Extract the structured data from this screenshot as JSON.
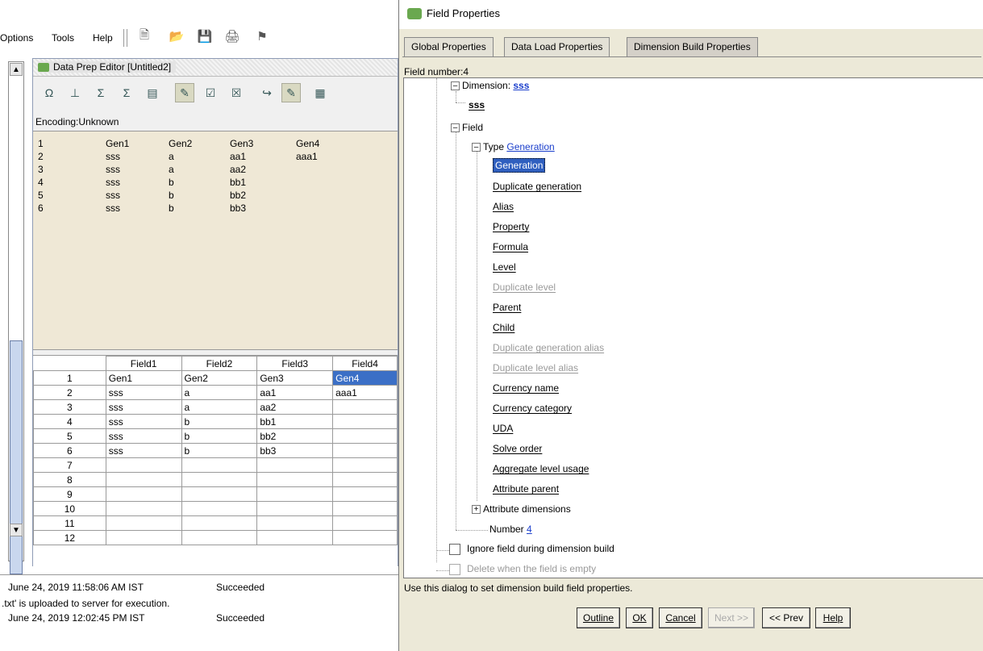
{
  "menus": [
    "Options",
    "Tools",
    "Help"
  ],
  "toolbar_icons": [
    "new-icon",
    "open-icon",
    "save-icon",
    "print-icon",
    "server-icon"
  ],
  "editor": {
    "title": "Data Prep Editor [Untitled2]",
    "encoding": "Encoding:Unknown",
    "raw_rows": [
      [
        "1",
        "Gen1",
        "Gen2",
        "Gen3",
        "Gen4"
      ],
      [
        "2",
        "sss",
        "a",
        "aa1",
        "aaa1"
      ],
      [
        "3",
        "sss",
        "a",
        "aa2",
        ""
      ],
      [
        "4",
        "sss",
        "b",
        "bb1",
        ""
      ],
      [
        "5",
        "sss",
        "b",
        "bb2",
        ""
      ],
      [
        "6",
        "sss",
        "b",
        "bb3",
        ""
      ]
    ],
    "grid_headers": [
      "",
      "Field1",
      "Field2",
      "Field3",
      "Field4"
    ],
    "grid_rows": [
      [
        "1",
        "Gen1",
        "Gen2",
        "Gen3",
        "Gen4"
      ],
      [
        "2",
        "sss",
        "a",
        "aa1",
        "aaa1"
      ],
      [
        "3",
        "sss",
        "a",
        "aa2",
        ""
      ],
      [
        "4",
        "sss",
        "b",
        "bb1",
        ""
      ],
      [
        "5",
        "sss",
        "b",
        "bb2",
        ""
      ],
      [
        "6",
        "sss",
        "b",
        "bb3",
        ""
      ],
      [
        "7",
        "",
        "",
        "",
        ""
      ],
      [
        "8",
        "",
        "",
        "",
        ""
      ],
      [
        "9",
        "",
        "",
        "",
        ""
      ],
      [
        "10",
        "",
        "",
        "",
        ""
      ],
      [
        "11",
        "",
        "",
        "",
        ""
      ],
      [
        "12",
        "",
        "",
        "",
        ""
      ]
    ]
  },
  "log": [
    {
      "time": "June 24, 2019 11:58:06 AM IST",
      "status": "Succeeded"
    },
    {
      "msg": ".txt' is uploaded to server for execution."
    },
    {
      "time": "June 24, 2019 12:02:45 PM IST",
      "status": "Succeeded"
    }
  ],
  "dialog": {
    "title": "Field Properties",
    "tabs": [
      "Global Properties",
      "Data Load Properties",
      "Dimension Build Properties"
    ],
    "field_number": "Field number:4",
    "dimension_label": "Dimension:",
    "dimension_value": "sss",
    "dimension_child": "sss",
    "field_label": "Field",
    "type_label": "Type",
    "type_value": "Generation",
    "type_options": [
      {
        "label": "Generation",
        "state": "selected"
      },
      {
        "label": "Duplicate generation",
        "state": "enabled"
      },
      {
        "label": "Alias",
        "state": "enabled"
      },
      {
        "label": "Property",
        "state": "enabled"
      },
      {
        "label": "Formula",
        "state": "enabled"
      },
      {
        "label": "Level",
        "state": "enabled"
      },
      {
        "label": "Duplicate level",
        "state": "disabled"
      },
      {
        "label": "Parent",
        "state": "enabled"
      },
      {
        "label": "Child",
        "state": "enabled"
      },
      {
        "label": "Duplicate generation alias",
        "state": "disabled"
      },
      {
        "label": "Duplicate level alias",
        "state": "disabled"
      },
      {
        "label": "Currency name",
        "state": "enabled"
      },
      {
        "label": "Currency category",
        "state": "enabled"
      },
      {
        "label": "UDA",
        "state": "enabled"
      },
      {
        "label": "Solve order",
        "state": "enabled"
      },
      {
        "label": "Aggregate level usage",
        "state": "enabled"
      },
      {
        "label": "Attribute parent",
        "state": "enabled"
      }
    ],
    "attribute_dimensions": "Attribute dimensions",
    "number_label": "Number",
    "number_value": "4",
    "ignore_label": "Ignore field during dimension build",
    "delete_label": "Delete when the field is empty",
    "hint": "Use this dialog to set dimension build field properties.",
    "buttons": {
      "outline": "Outline",
      "ok": "OK",
      "cancel": "Cancel",
      "next": "Next >>",
      "prev": "<< Prev",
      "help": "Help"
    }
  }
}
